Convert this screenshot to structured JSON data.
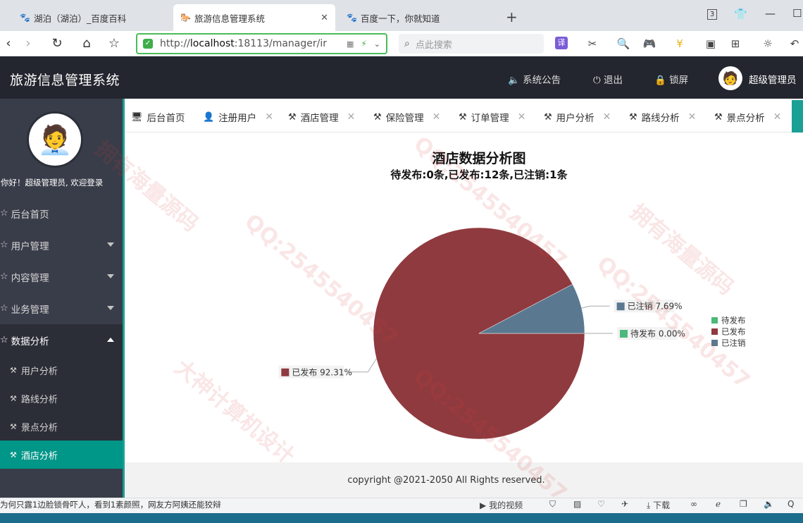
{
  "browser": {
    "tabs": [
      {
        "label": "湖泊（湖泊）_百度百科",
        "icon": "baidu-paw-icon",
        "active": false
      },
      {
        "label": "旅游信息管理系统",
        "icon": "horse-icon",
        "active": true
      },
      {
        "label": "百度一下，你就知道",
        "icon": "baidu-paw-icon",
        "active": false
      }
    ],
    "new_tab": "+",
    "tab_count": "3",
    "url_prefix": "http://",
    "url_host": "localhost",
    "url_rest": ":18113/manager/ir",
    "search_placeholder": "点此搜索",
    "translate_label": "译"
  },
  "app": {
    "title": "旅游信息管理系统",
    "header_links": {
      "announcement": "系统公告",
      "logout": "退出",
      "lock": "锁屏",
      "user": "超级管理员"
    }
  },
  "sidebar": {
    "welcome": "你好！超级管理员, 欢迎登录",
    "menu": [
      {
        "label": "后台首页",
        "has_caret": false
      },
      {
        "label": "用户管理",
        "has_caret": true
      },
      {
        "label": "内容管理",
        "has_caret": true
      },
      {
        "label": "业务管理",
        "has_caret": true
      },
      {
        "label": "数据分析",
        "has_caret": true,
        "open": true
      }
    ],
    "submenu": [
      {
        "label": "用户分析",
        "active": false
      },
      {
        "label": "路线分析",
        "active": false
      },
      {
        "label": "景点分析",
        "active": false
      },
      {
        "label": "酒店分析",
        "active": true
      }
    ]
  },
  "content_tabs": [
    {
      "label": "后台首页",
      "icon": "monitor-icon",
      "closable": false
    },
    {
      "label": "注册用户",
      "icon": "user-icon",
      "closable": true
    },
    {
      "label": "酒店管理",
      "icon": "tools-icon",
      "closable": true
    },
    {
      "label": "保险管理",
      "icon": "tools-icon",
      "closable": true
    },
    {
      "label": "订单管理",
      "icon": "tools-icon",
      "closable": true
    },
    {
      "label": "用户分析",
      "icon": "tools-icon",
      "closable": true
    },
    {
      "label": "路线分析",
      "icon": "tools-icon",
      "closable": true
    },
    {
      "label": "景点分析",
      "icon": "tools-icon",
      "closable": true
    }
  ],
  "chart_data": {
    "type": "pie",
    "title": "酒店数据分析图",
    "subtitle": "待发布:0条,已发布:12条,已注销:1条",
    "slices": [
      {
        "name": "待发布",
        "value": 0,
        "percent": "0.00%",
        "color": "#4cb87a"
      },
      {
        "name": "已发布",
        "value": 12,
        "percent": "92.31%",
        "color": "#8f3a3f"
      },
      {
        "name": "已注销",
        "value": 1,
        "percent": "7.69%",
        "color": "#5a7991"
      }
    ],
    "legend_position": "right"
  },
  "footer": {
    "copyright": "copyright @2021-2050 All Rights reserved."
  },
  "statusbar": {
    "news": "为何只露1边脸锁骨吓人，看到1素颜照，网友方阿姨还能狡辩",
    "my_video": "我的视频",
    "download": "下载"
  },
  "watermarks": [
    "QQ:2545540457",
    "大神计算机设计",
    "拥有海量源码"
  ]
}
